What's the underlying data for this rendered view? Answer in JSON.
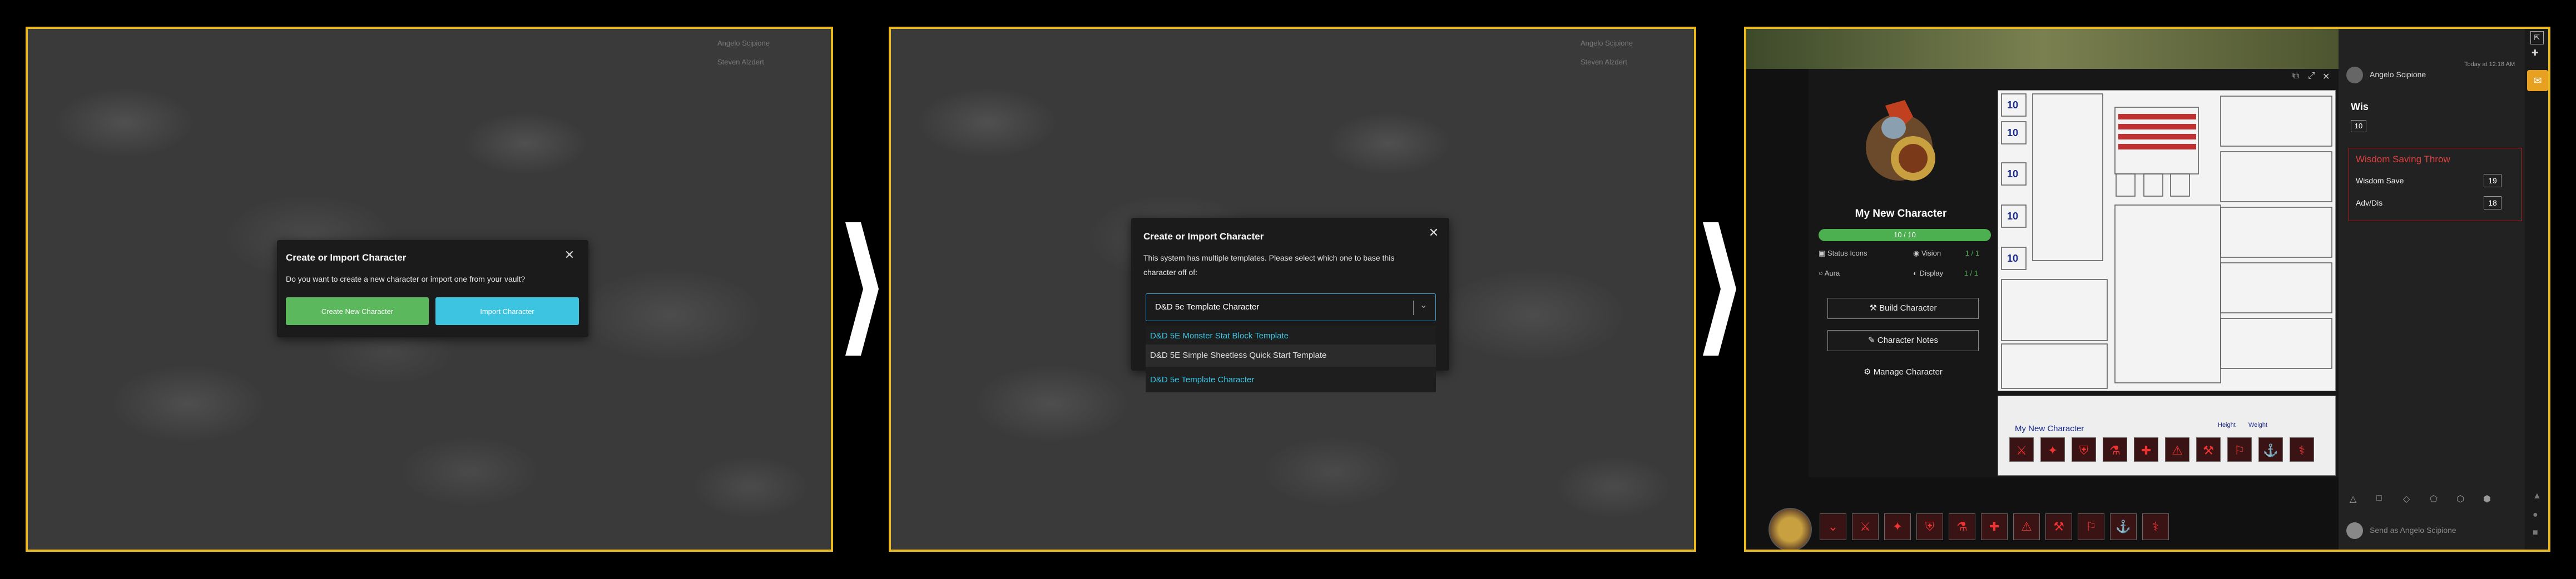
{
  "panel1": {
    "bg_user": "Angelo Scipione",
    "bg_user2": "Steven Alzdert",
    "dialog": {
      "title": "Create or Import Character",
      "text": "Do you want to create a new character or import one from your vault?",
      "create_label": "Create New Character",
      "import_label": "Import Character",
      "create_color": "#5cb85c",
      "import_color": "#3dc4e0"
    }
  },
  "panel2": {
    "bg_user": "Angelo Scipione",
    "bg_user2": "Steven Alzdert",
    "dialog": {
      "title": "Create or Import Character",
      "text_line1": "This system has multiple templates. Please select which one to base this",
      "text_line2": "character off of:",
      "selected": "D&D 5e Template Character",
      "options": [
        "D&D 5E Monster Stat Block Template",
        "D&D 5E Simple Sheetless Quick Start Template",
        "D&D 5e Template Character"
      ]
    }
  },
  "panel3": {
    "character_name": "My New Character",
    "hp": "10 / 10",
    "status_icons": "Status Icons",
    "vision": "Vision",
    "vision_value": "1 / 1",
    "aura": "Aura",
    "display": "Display",
    "display_value": "1 / 1",
    "build_label": "Build Character",
    "notes_label": "Character Notes",
    "manage_label": "Manage Character",
    "sheet_nameplate": "My New Character",
    "sheet_fields": [
      "Height",
      "Weight"
    ],
    "chat": {
      "user": "Angelo Scipione",
      "time": "Today at 12:18 AM",
      "roll_title": "Wis",
      "roll_value": "10",
      "save_title": "Wisdom Saving Throw",
      "save_label": "Wisdom Save",
      "save_value": "19",
      "adv_label": "Adv/Dis",
      "adv_value": "18",
      "input_placeholder": "Send as Angelo Scipione"
    },
    "accent": "#e04040"
  }
}
